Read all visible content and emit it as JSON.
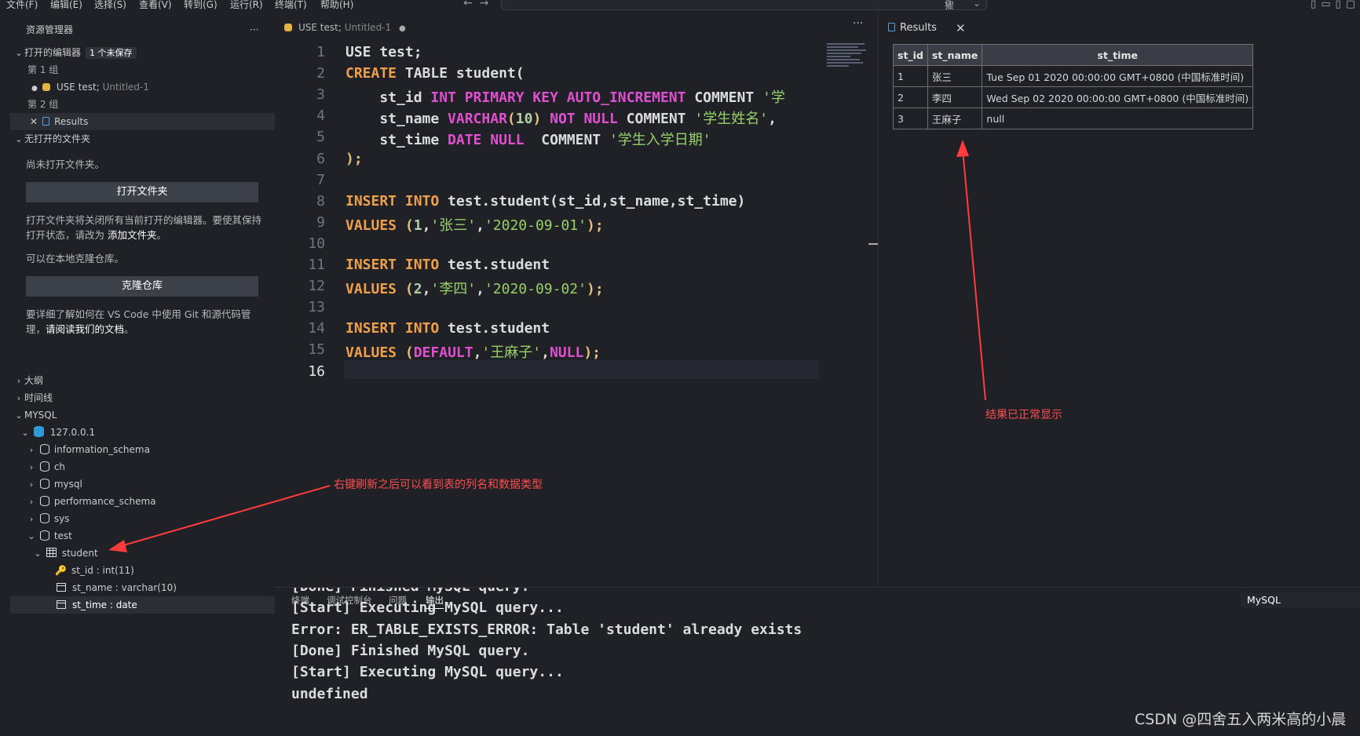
{
  "menubar": {
    "items": [
      "文件(F)",
      "编辑(E)",
      "选择(S)",
      "查看(V)",
      "转到(G)",
      "运行(R)",
      "终端(T)",
      "帮助(H)"
    ],
    "search_placeholder": "搜索"
  },
  "sidebar": {
    "title": "资源管理器",
    "open_editors": {
      "label": "打开的编辑器",
      "badge": "1 个未保存",
      "group1": "第 1 组",
      "file1_name": "USE test;",
      "file1_desc": "Untitled-1",
      "group2": "第 2 组",
      "file2_name": "Results"
    },
    "no_folder": {
      "label": "无打开的文件夹",
      "msg1": "尚未打开文件夹。",
      "open_folder_button": "打开文件夹",
      "msg2": "打开文件夹将关闭所有当前打开的编辑器。要使其保持打开状态，请改为",
      "msg2_link": "添加文件夹",
      "msg3": "可以在本地克隆仓库。",
      "clone_button": "克隆仓库",
      "msg4": "要详细了解如何在 VS Code 中使用 Git 和源代码管理，",
      "msg4_link": "请阅读我们的文档"
    },
    "outline": "大纲",
    "timeline": "时间线",
    "mysql": "MYSQL",
    "server": "127.0.0.1",
    "databases": [
      "information_schema",
      "ch",
      "mysql",
      "performance_schema",
      "sys",
      "test"
    ],
    "table": "student",
    "columns": [
      "st_id : int(11)",
      "st_name : varchar(10)",
      "st_time : date"
    ]
  },
  "editor": {
    "tab_title": "USE test;",
    "tab_desc": "Untitled-1",
    "lines": [
      [
        [
          "tx",
          "USE test;"
        ]
      ],
      [
        [
          "ko",
          "CREATE"
        ],
        [
          "tx",
          " TABLE student("
        ]
      ],
      [
        [
          "tx",
          "    st_id "
        ],
        [
          "kw",
          "INT PRIMARY KEY AUTO_INCREMENT"
        ],
        [
          "tx",
          " COMMENT "
        ],
        [
          "st",
          "'学"
        ]
      ],
      [
        [
          "tx",
          "    st_name "
        ],
        [
          "kw",
          "VARCHAR"
        ],
        [
          "pn",
          "("
        ],
        [
          "nm",
          "10"
        ],
        [
          "pn",
          ")"
        ],
        [
          "kw",
          " NOT NULL"
        ],
        [
          "tx",
          " COMMENT "
        ],
        [
          "st",
          "'学生姓名'"
        ],
        [
          "tx",
          ","
        ]
      ],
      [
        [
          "tx",
          "    st_time "
        ],
        [
          "kw",
          "DATE NULL"
        ],
        [
          "tx",
          "  COMMENT "
        ],
        [
          "st",
          "'学生入学日期'"
        ]
      ],
      [
        [
          "pn",
          ");"
        ]
      ],
      [],
      [
        [
          "ko",
          "INSERT INTO"
        ],
        [
          "tx",
          " test.student(st_id,st_name,st_time)"
        ]
      ],
      [
        [
          "ko",
          "VALUES"
        ],
        [
          "tx",
          " "
        ],
        [
          "pn",
          "("
        ],
        [
          "nm",
          "1"
        ],
        [
          "tx",
          ","
        ],
        [
          "st",
          "'张三'"
        ],
        [
          "tx",
          ","
        ],
        [
          "st",
          "'2020-09-01'"
        ],
        [
          "pn",
          ");"
        ]
      ],
      [],
      [
        [
          "ko",
          "INSERT INTO"
        ],
        [
          "tx",
          " test.student"
        ]
      ],
      [
        [
          "ko",
          "VALUES"
        ],
        [
          "tx",
          " "
        ],
        [
          "pn",
          "("
        ],
        [
          "nm",
          "2"
        ],
        [
          "tx",
          ","
        ],
        [
          "st",
          "'李四'"
        ],
        [
          "tx",
          ","
        ],
        [
          "st",
          "'2020-09-02'"
        ],
        [
          "pn",
          ");"
        ]
      ],
      [],
      [
        [
          "ko",
          "INSERT INTO"
        ],
        [
          "tx",
          " test.student"
        ]
      ],
      [
        [
          "ko",
          "VALUES"
        ],
        [
          "tx",
          " "
        ],
        [
          "pn",
          "("
        ],
        [
          "kw",
          "DEFAULT"
        ],
        [
          "tx",
          ","
        ],
        [
          "st",
          "'王麻子'"
        ],
        [
          "tx",
          ","
        ],
        [
          "kw",
          "NULL"
        ],
        [
          "pn",
          ");"
        ]
      ],
      []
    ]
  },
  "results": {
    "tab_title": "Results",
    "columns": [
      "st_id",
      "st_name",
      "st_time"
    ],
    "rows": [
      [
        "1",
        "张三",
        "Tue Sep 01 2020 00:00:00 GMT+0800 (中国标准时间)"
      ],
      [
        "2",
        "李四",
        "Wed Sep 02 2020 00:00:00 GMT+0800 (中国标准时间)"
      ],
      [
        "3",
        "王麻子",
        "null"
      ]
    ]
  },
  "annotations": {
    "results": "结果已正常显示",
    "sidebar": "右键刷新之后可以看到表的列名和数据类型"
  },
  "panel": {
    "tabs": [
      "终端",
      "调试控制台",
      "问题",
      "输出"
    ],
    "active_tab": "输出",
    "channel": "MySQL",
    "output_lines": [
      "[Done] Finished MySQL query.",
      "[Start] Executing MySQL query...",
      "Error: ER_TABLE_EXISTS_ERROR: Table 'student' already exists",
      "[Done] Finished MySQL query.",
      "[Start] Executing MySQL query...",
      "undefined"
    ]
  },
  "watermark": "CSDN @四舍五入两米高的小晨",
  "colors": {
    "annotation": "#ff4d4d",
    "keyword": "#e04fd0",
    "keyword2": "#f0a04b",
    "string": "#98d06a"
  }
}
